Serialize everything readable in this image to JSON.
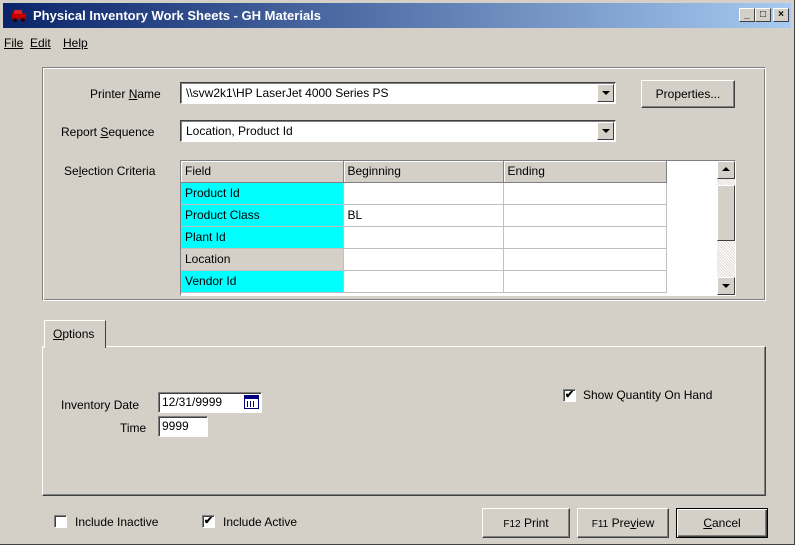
{
  "window": {
    "title": "Physical Inventory Work Sheets - GH Materials",
    "min_label": "_",
    "max_label": "□",
    "close_label": "×"
  },
  "menu": {
    "file": "File",
    "edit": "Edit",
    "help": "Help"
  },
  "printer": {
    "label_pre": "Printer ",
    "label_u": "N",
    "label_post": "ame",
    "value": "\\\\svw2k1\\HP LaserJet 4000 Series PS",
    "properties_button": "Properties..."
  },
  "sequence": {
    "label_pre": "Report ",
    "label_u": "S",
    "label_post": "equence",
    "value": "Location, Product Id"
  },
  "selection": {
    "label_pre": "Se",
    "label_u": "l",
    "label_post": "ection Criteria",
    "columns": [
      "Field",
      "Beginning",
      "Ending"
    ],
    "rows": [
      {
        "field": "Product Id",
        "beginning": "",
        "ending": "",
        "highlight": true
      },
      {
        "field": "Product Class",
        "beginning": "BL",
        "ending": "",
        "highlight": true
      },
      {
        "field": "Plant Id",
        "beginning": "",
        "ending": "",
        "highlight": true
      },
      {
        "field": "Location",
        "beginning": "",
        "ending": "",
        "highlight": false
      },
      {
        "field": "Vendor Id",
        "beginning": "",
        "ending": "",
        "highlight": true
      }
    ]
  },
  "options": {
    "tab_label_u": "O",
    "tab_label_post": "ptions",
    "inventory_date_label": "Inventory Date",
    "inventory_date_value": "12/31/9999",
    "time_label": "Time",
    "time_value": "9999",
    "show_qty_label": "Show Quantity On Hand",
    "show_qty_checked": "✔"
  },
  "footer": {
    "include_inactive_label": "Include Inactive",
    "include_inactive_checked": "",
    "include_active_label": "Include Active",
    "include_active_checked": "✔",
    "print_key": "F12",
    "print_label": "Print",
    "preview_key": "F11",
    "preview_pre": "Pre",
    "preview_u": "v",
    "preview_post": "iew",
    "cancel_u": "C",
    "cancel_post": "ancel"
  },
  "colors": {
    "highlight_cell": "#00ffff",
    "titlebar_start": "#0a246a",
    "titlebar_end": "#a6caf0"
  }
}
